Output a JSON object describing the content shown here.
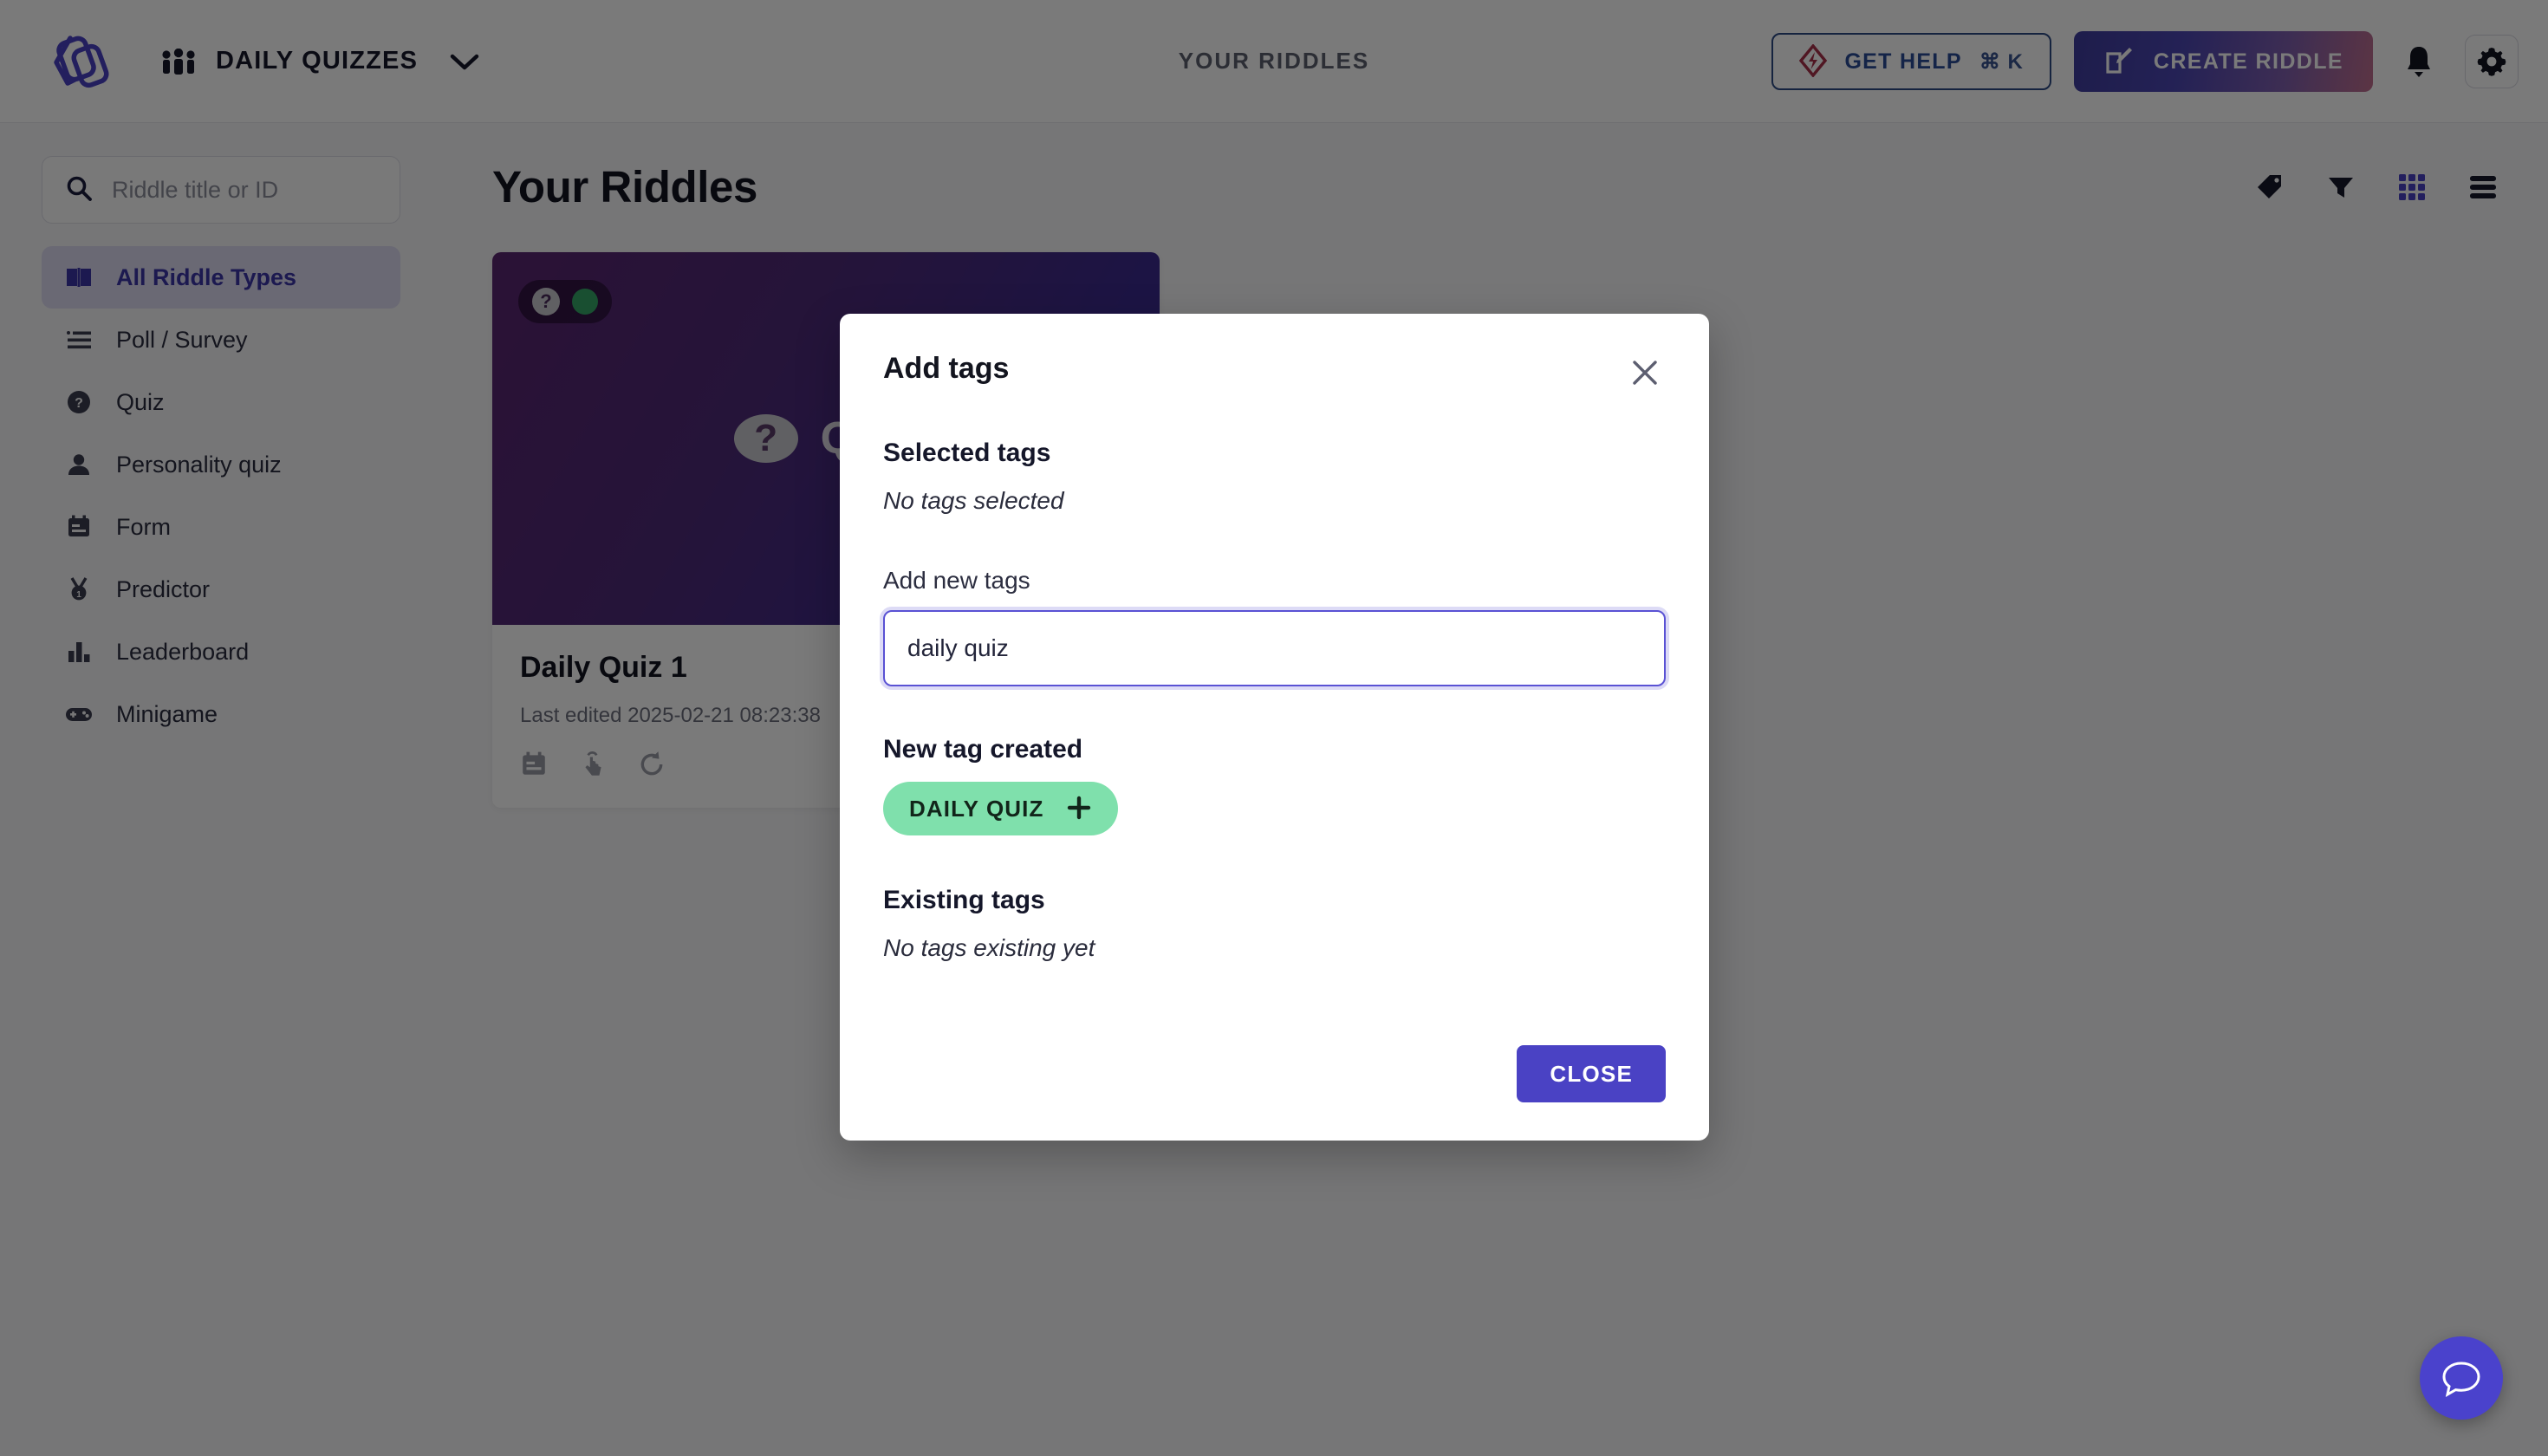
{
  "header": {
    "logo_icon": "riddle-logo-icon",
    "people_icon": "people-icon",
    "workspace": "DAILY QUIZZES",
    "workspace_chevron_icon": "chevron-down-icon",
    "center_title": "YOUR RIDDLES",
    "get_help": {
      "icon": "diamond-bolt-icon",
      "label": "GET HELP",
      "shortcut": "⌘ K"
    },
    "create_riddle": {
      "icon": "edit-square-icon",
      "label": "CREATE RIDDLE"
    },
    "notifications_icon": "bell-icon",
    "settings_icon": "gear-icon",
    "accent_gradient_start": "#3f3d9e",
    "accent_gradient_end": "#c06f8e"
  },
  "sidebar": {
    "search": {
      "icon": "search-icon",
      "value": "",
      "placeholder": "Riddle title or ID"
    },
    "items": [
      {
        "label": "All Riddle Types",
        "icon": "book-icon",
        "active": true
      },
      {
        "label": "Poll / Survey",
        "icon": "list-icon",
        "active": false
      },
      {
        "label": "Quiz",
        "icon": "question-circle-icon",
        "active": false
      },
      {
        "label": "Personality quiz",
        "icon": "person-icon",
        "active": false
      },
      {
        "label": "Form",
        "icon": "form-icon",
        "active": false
      },
      {
        "label": "Predictor",
        "icon": "medal-icon",
        "active": false
      },
      {
        "label": "Leaderboard",
        "icon": "bar-chart-icon",
        "active": false
      },
      {
        "label": "Minigame",
        "icon": "gamepad-icon",
        "active": false
      }
    ],
    "active_bg": "#dedcf2",
    "active_color": "#3b36a8"
  },
  "main": {
    "page_title": "Your Riddles",
    "tools": [
      {
        "name": "tag-icon",
        "label": "Tags",
        "active": false
      },
      {
        "name": "filter-icon",
        "label": "Filter",
        "active": false
      },
      {
        "name": "grid-view-icon",
        "label": "Grid view",
        "active": true
      },
      {
        "name": "list-view-icon",
        "label": "List view",
        "active": false
      }
    ],
    "cards": [
      {
        "title": "Daily Quiz 1",
        "subtitle": "Last edited 2025-02-21 08:23:38",
        "cover_label": "Quiz",
        "cover_icon": "question-circle-icon",
        "badge_icon": "question-circle-icon",
        "status_dot_color": "#35a567",
        "actions": [
          {
            "name": "form-icon"
          },
          {
            "name": "click-hand-icon"
          },
          {
            "name": "refresh-icon"
          }
        ]
      }
    ]
  },
  "modal": {
    "title": "Add tags",
    "close_icon": "close-icon",
    "selected_tags_heading": "Selected tags",
    "selected_tags_empty": "No tags selected",
    "add_new_tags_label": "Add new tags",
    "tag_input_value": "daily quiz",
    "tag_input_placeholder": "",
    "new_tag_heading": "New tag created",
    "new_tag_chip": {
      "label": "DAILY QUIZ",
      "icon": "plus-icon",
      "color": "#7fe0ac"
    },
    "existing_tags_heading": "Existing tags",
    "existing_tags_empty": "No tags existing yet",
    "close_button": "CLOSE",
    "close_button_color": "#4a42c4"
  },
  "fab": {
    "icon": "chat-bubble-icon",
    "color": "#4a42cc"
  }
}
